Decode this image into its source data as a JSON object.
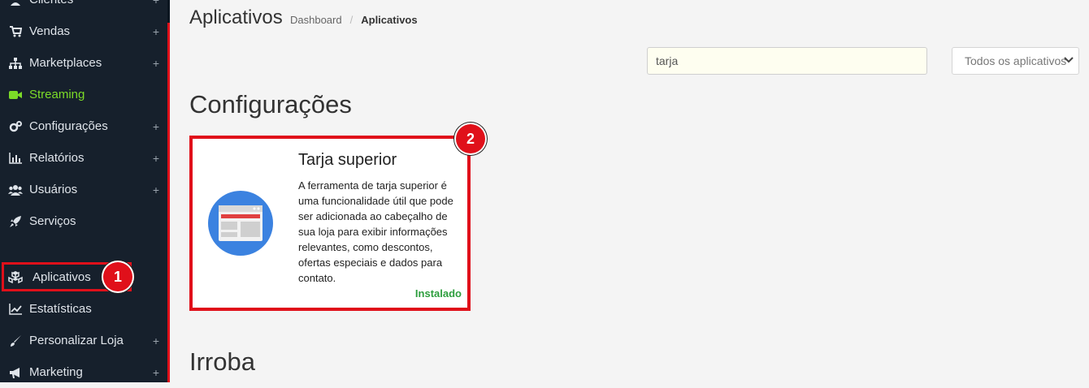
{
  "sidebar": {
    "items": [
      {
        "label": "Clientes",
        "icon": "users-icon",
        "plus": "+"
      },
      {
        "label": "Vendas",
        "icon": "cart-icon",
        "plus": "+"
      },
      {
        "label": "Marketplaces",
        "icon": "sitemap-icon",
        "plus": "+"
      },
      {
        "label": "Streaming",
        "icon": "video-icon",
        "plus": ""
      },
      {
        "label": "Configurações",
        "icon": "gears-icon",
        "plus": "+"
      },
      {
        "label": "Relatórios",
        "icon": "bar-chart-icon",
        "plus": "+"
      },
      {
        "label": "Usuários",
        "icon": "users-group-icon",
        "plus": "+"
      },
      {
        "label": "Serviços",
        "icon": "rocket-icon",
        "plus": ""
      },
      {
        "label": "Aplicativos",
        "icon": "cubes-icon",
        "plus": ""
      },
      {
        "label": "Estatísticas",
        "icon": "line-chart-icon",
        "plus": ""
      },
      {
        "label": "Personalizar Loja",
        "icon": "brush-icon",
        "plus": "+"
      },
      {
        "label": "Marketing",
        "icon": "bullhorn-icon",
        "plus": "+"
      }
    ],
    "active_color": "#7cdb28"
  },
  "annotations": {
    "badge1": "1",
    "badge2": "2",
    "highlight_color": "#e0101a"
  },
  "header": {
    "title": "Aplicativos",
    "breadcrumb": {
      "home": "Dashboard",
      "separator": "/",
      "current": "Aplicativos"
    }
  },
  "filters": {
    "search_value": "tarja",
    "select_value": "Todos os aplicativos"
  },
  "sections": [
    {
      "title": "Configurações",
      "apps": [
        {
          "title": "Tarja superior",
          "description": "A ferramenta de tarja superior é uma funcionalidade útil que pode ser adicionada ao cabeçalho de sua loja para exibir informações relevantes, como descontos, ofertas especiais e dados para contato.",
          "status": "Instalado",
          "icon": "browser-window-icon"
        }
      ]
    },
    {
      "title": "Irroba"
    }
  ]
}
